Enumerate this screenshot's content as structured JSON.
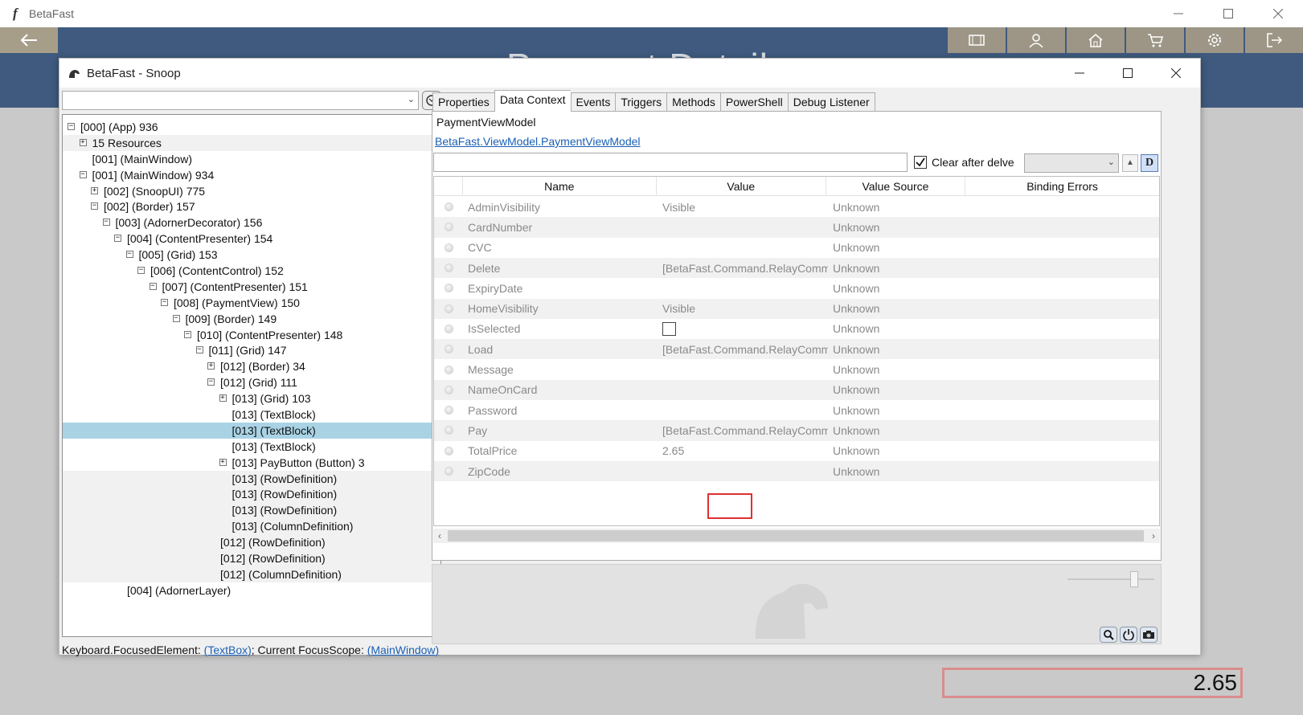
{
  "app": {
    "title": "BetaFast",
    "logo_glyph": "f",
    "page_heading": "Payment Details",
    "total_display": "2.65",
    "window_controls": [
      "minimize-icon",
      "maximize-icon",
      "close-icon"
    ],
    "nav_icons": [
      "movie-icon",
      "user-icon",
      "home-icon",
      "cart-icon",
      "gear-icon",
      "logout-icon"
    ],
    "colors": {
      "header": "#3f5a7e",
      "nav_button": "#9d9686",
      "back_button": "#a79e8a",
      "total_border": "#d98d8d"
    }
  },
  "snoop": {
    "title": "BetaFast - Snoop",
    "tree": [
      {
        "indent": 0,
        "expander": "minus",
        "label": "[000]  (App) 936",
        "band": false
      },
      {
        "indent": 1,
        "expander": "plus",
        "label": "15 Resources",
        "band": true
      },
      {
        "indent": 1,
        "expander": "",
        "label": "[001]  (MainWindow)",
        "band": false
      },
      {
        "indent": 1,
        "expander": "minus",
        "label": "[001]  (MainWindow) 934",
        "band": false
      },
      {
        "indent": 2,
        "expander": "plus",
        "label": "[002]  (SnoopUI) 775",
        "band": false
      },
      {
        "indent": 2,
        "expander": "minus",
        "label": "[002]  (Border) 157",
        "band": false
      },
      {
        "indent": 3,
        "expander": "minus",
        "label": "[003]  (AdornerDecorator) 156",
        "band": false
      },
      {
        "indent": 4,
        "expander": "minus",
        "label": "[004]  (ContentPresenter) 154",
        "band": false
      },
      {
        "indent": 5,
        "expander": "minus",
        "label": "[005]  (Grid) 153",
        "band": false
      },
      {
        "indent": 6,
        "expander": "minus",
        "label": "[006]  (ContentControl) 152",
        "band": false
      },
      {
        "indent": 7,
        "expander": "minus",
        "label": "[007]  (ContentPresenter) 151",
        "band": false
      },
      {
        "indent": 8,
        "expander": "minus",
        "label": "[008]  (PaymentView) 150",
        "band": false
      },
      {
        "indent": 9,
        "expander": "minus",
        "label": "[009]  (Border) 149",
        "band": false
      },
      {
        "indent": 10,
        "expander": "minus",
        "label": "[010]  (ContentPresenter) 148",
        "band": false
      },
      {
        "indent": 11,
        "expander": "minus",
        "label": "[011]  (Grid) 147",
        "band": false
      },
      {
        "indent": 12,
        "expander": "plus",
        "label": "[012]  (Border) 34",
        "band": false
      },
      {
        "indent": 12,
        "expander": "minus",
        "label": "[012]  (Grid) 111",
        "band": false
      },
      {
        "indent": 13,
        "expander": "plus",
        "label": "[013]  (Grid) 103",
        "band": false
      },
      {
        "indent": 13,
        "expander": "",
        "label": "[013]  (TextBlock)",
        "band": false
      },
      {
        "indent": 13,
        "expander": "",
        "label": "[013]  (TextBlock)",
        "band": false,
        "selected": true
      },
      {
        "indent": 13,
        "expander": "",
        "label": "[013]  (TextBlock)",
        "band": false
      },
      {
        "indent": 13,
        "expander": "plus",
        "label": "[013] PayButton (Button) 3",
        "band": false
      },
      {
        "indent": 13,
        "expander": "",
        "label": "[013]  (RowDefinition)",
        "band": true
      },
      {
        "indent": 13,
        "expander": "",
        "label": "[013]  (RowDefinition)",
        "band": true
      },
      {
        "indent": 13,
        "expander": "",
        "label": "[013]  (RowDefinition)",
        "band": true
      },
      {
        "indent": 13,
        "expander": "",
        "label": "[013]  (ColumnDefinition)",
        "band": true
      },
      {
        "indent": 12,
        "expander": "",
        "label": "[012]  (RowDefinition)",
        "band": true
      },
      {
        "indent": 12,
        "expander": "",
        "label": "[012]  (RowDefinition)",
        "band": true
      },
      {
        "indent": 12,
        "expander": "",
        "label": "[012]  (ColumnDefinition)",
        "band": true
      },
      {
        "indent": 4,
        "expander": "",
        "label": "[004]  (AdornerLayer)",
        "band": false
      }
    ],
    "status": {
      "prefix": "Keyboard.FocusedElement: ",
      "focused_link": "(TextBox)",
      "middle": "; Current FocusScope: ",
      "scope_link": "(MainWindow)"
    },
    "tabs": [
      {
        "label": "Properties",
        "active": false
      },
      {
        "label": "Data Context",
        "active": true
      },
      {
        "label": "Events",
        "active": false
      },
      {
        "label": "Triggers",
        "active": false
      },
      {
        "label": "Methods",
        "active": false
      },
      {
        "label": "PowerShell",
        "active": false
      },
      {
        "label": "Debug Listener",
        "active": false
      }
    ],
    "data_context": {
      "view_model_name": "PaymentViewModel",
      "view_model_type": "BetaFast.ViewModel.PaymentViewModel",
      "filter_value": "",
      "clear_after_delve_label": "Clear after delve",
      "clear_after_delve_checked": true,
      "d_button_label": "D",
      "columns": [
        "Name",
        "Value",
        "Value Source",
        "Binding Errors"
      ],
      "rows": [
        {
          "name": "AdminVisibility",
          "value": "Visible",
          "source": "Unknown",
          "band": false
        },
        {
          "name": "CardNumber",
          "value": "",
          "source": "Unknown",
          "band": true
        },
        {
          "name": "CVC",
          "value": "",
          "source": "Unknown",
          "band": false
        },
        {
          "name": "Delete",
          "value": "[BetaFast.Command.RelayCommand]",
          "source": "Unknown",
          "band": true
        },
        {
          "name": "ExpiryDate",
          "value": "",
          "source": "Unknown",
          "band": false
        },
        {
          "name": "HomeVisibility",
          "value": "Visible",
          "source": "Unknown",
          "band": true
        },
        {
          "name": "IsSelected",
          "value": "",
          "checkbox": true,
          "source": "Unknown",
          "band": false
        },
        {
          "name": "Load",
          "value": "[BetaFast.Command.RelayCommand]",
          "source": "Unknown",
          "band": true
        },
        {
          "name": "Message",
          "value": "",
          "source": "Unknown",
          "band": false
        },
        {
          "name": "NameOnCard",
          "value": "",
          "source": "Unknown",
          "band": true
        },
        {
          "name": "Password",
          "value": "",
          "source": "Unknown",
          "band": false
        },
        {
          "name": "Pay",
          "value": "[BetaFast.Command.RelayCommand]",
          "source": "Unknown",
          "band": true
        },
        {
          "name": "TotalPrice",
          "value": "2.65",
          "source": "Unknown",
          "band": false,
          "highlight": true
        },
        {
          "name": "ZipCode",
          "value": "",
          "source": "Unknown",
          "band": true
        }
      ]
    },
    "preview_tools": [
      "magnifier-icon",
      "power-icon",
      "camera-icon"
    ]
  }
}
